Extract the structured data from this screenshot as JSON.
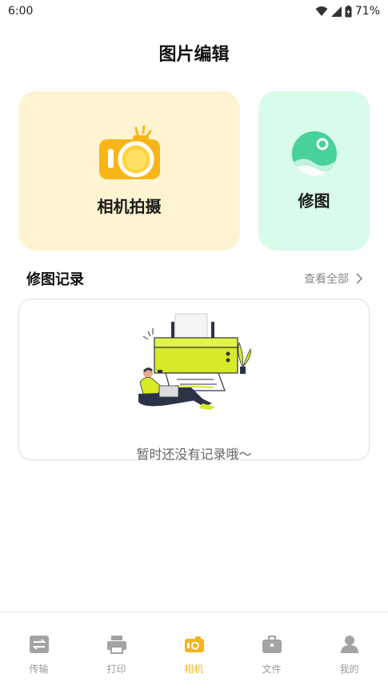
{
  "status_bar": {
    "time": "6:00",
    "battery": "71%"
  },
  "header": {
    "title": "图片编辑"
  },
  "cards": {
    "camera": {
      "label": "相机拍摄"
    },
    "edit": {
      "label": "修图"
    }
  },
  "history": {
    "title": "修图记录",
    "view_all": "查看全部",
    "empty_text": "暂时还没有记录哦～"
  },
  "tabs": [
    {
      "label": "传输",
      "icon": "transfer-icon"
    },
    {
      "label": "打印",
      "icon": "printer-icon"
    },
    {
      "label": "相机",
      "icon": "camera-icon",
      "active": true
    },
    {
      "label": "文件",
      "icon": "briefcase-icon"
    },
    {
      "label": "我的",
      "icon": "user-icon"
    }
  ],
  "colors": {
    "accent": "#f3b41f",
    "camera_card_bg": "#fff4d1",
    "edit_card_bg": "#d9fbe9",
    "tab_inactive": "#9a9a9a"
  }
}
